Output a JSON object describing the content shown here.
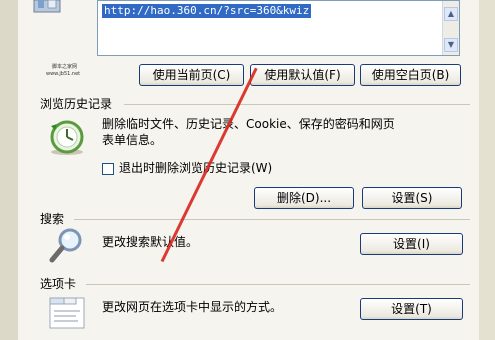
{
  "homepage": {
    "url": "http://hao.360.cn/?src=360&kwiz",
    "buttons": {
      "use_current": "使用当前页(C)",
      "use_default": "使用默认值(F)",
      "use_blank": "使用空白页(B)"
    },
    "watermark_line1": "脚本之家网",
    "watermark_line2": "www.jb51.net"
  },
  "history": {
    "title": "浏览历史记录",
    "description_line1": "删除临时文件、历史记录、Cookie、保存的密码和网页",
    "description_line2": "表单信息。",
    "checkbox_label": "退出时删除浏览历史记录(W)",
    "delete_button": "删除(D)...",
    "settings_button": "设置(S)"
  },
  "search": {
    "title": "搜索",
    "description": "更改搜索默认值。",
    "settings_button": "设置(I)"
  },
  "tabs": {
    "title": "选项卡",
    "description": "更改网页在选项卡中显示的方式。",
    "settings_button": "设置(T)"
  },
  "colors": {
    "annotation_line": "#d9281f",
    "selection": "#316ac5"
  }
}
